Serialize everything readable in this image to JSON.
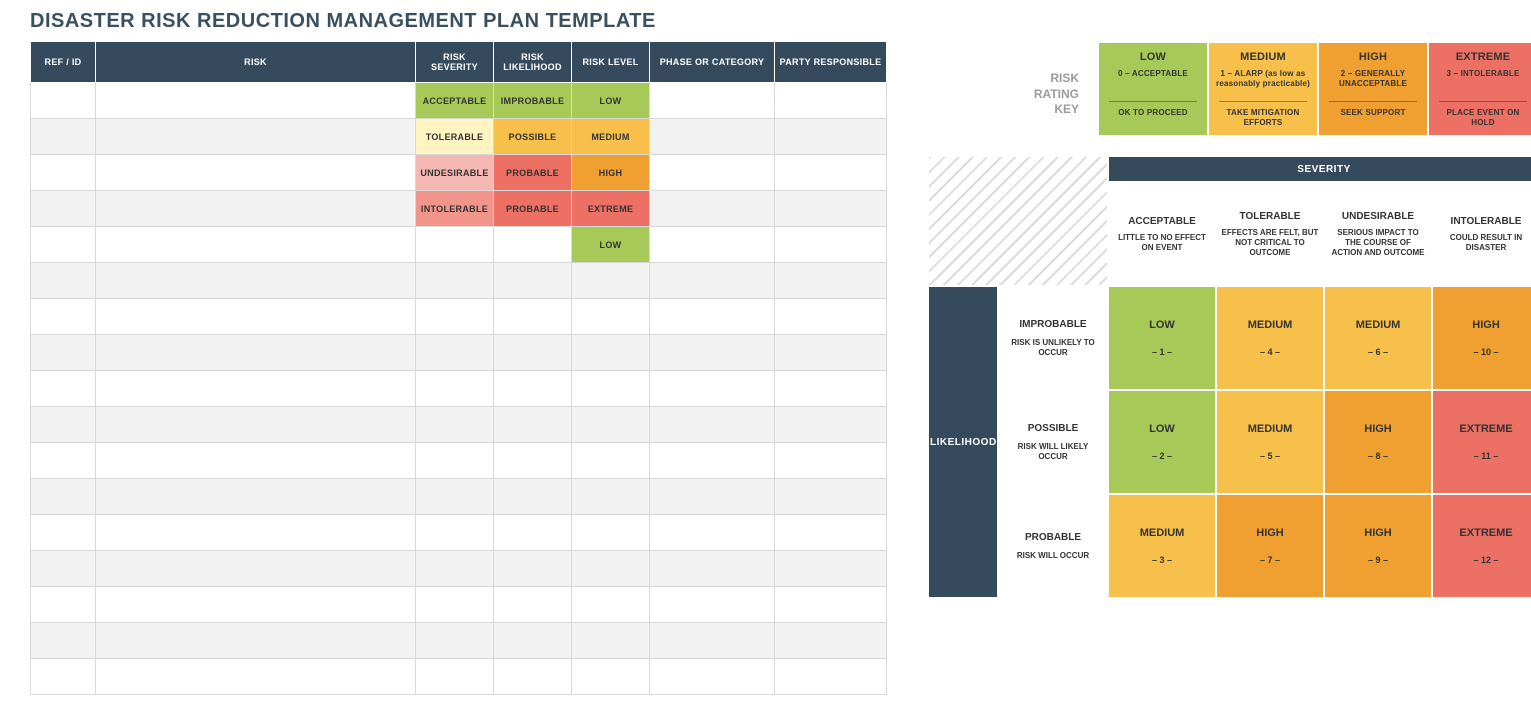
{
  "title": "DISASTER RISK REDUCTION MANAGEMENT PLAN TEMPLATE",
  "table": {
    "headers": [
      "REF / ID",
      "RISK",
      "RISK SEVERITY",
      "RISK LIKELIHOOD",
      "RISK LEVEL",
      "PHASE  OR CATEGORY",
      "PARTY RESPONSIBLE"
    ],
    "rows": [
      {
        "severity": "ACCEPTABLE",
        "likelihood": "IMPROBABLE",
        "level": "LOW",
        "sev_cls": "c-green",
        "lik_cls": "c-green",
        "lvl_cls": "c-green"
      },
      {
        "severity": "TOLERABLE",
        "likelihood": "POSSIBLE",
        "level": "MEDIUM",
        "sev_cls": "c-yellowlt",
        "lik_cls": "c-amber",
        "lvl_cls": "c-amber"
      },
      {
        "severity": "UNDESIRABLE",
        "likelihood": "PROBABLE",
        "level": "HIGH",
        "sev_cls": "c-pinklt",
        "lik_cls": "c-red",
        "lvl_cls": "c-orange"
      },
      {
        "severity": "INTOLERABLE",
        "likelihood": "PROBABLE",
        "level": "EXTREME",
        "sev_cls": "c-pink",
        "lik_cls": "c-red",
        "lvl_cls": "c-red"
      },
      {
        "severity": "",
        "likelihood": "",
        "level": "LOW",
        "sev_cls": "",
        "lik_cls": "",
        "lvl_cls": "c-green"
      },
      {},
      {},
      {},
      {},
      {},
      {},
      {},
      {},
      {},
      {},
      {},
      {}
    ]
  },
  "rating_key": {
    "label_line1": "RISK",
    "label_line2": "RATING",
    "label_line3": "KEY",
    "boxes": [
      {
        "title": "LOW",
        "sub": "0 – ACCEPTABLE",
        "action": "OK TO PROCEED",
        "cls": "c-green"
      },
      {
        "title": "MEDIUM",
        "sub": "1 – ALARP (as low as reasonably practicable)",
        "action": "TAKE MITIGATION EFFORTS",
        "cls": "c-amber"
      },
      {
        "title": "HIGH",
        "sub": "2 – GENERALLY UNACCEPTABLE",
        "action": "SEEK SUPPORT",
        "cls": "c-orange"
      },
      {
        "title": "EXTREME",
        "sub": "3 – INTOLERABLE",
        "action": "PLACE EVENT ON HOLD",
        "cls": "c-red"
      }
    ]
  },
  "matrix": {
    "severity_label": "SEVERITY",
    "likelihood_label": "LIKELIHOOD",
    "severity": [
      {
        "name": "ACCEPTABLE",
        "desc": "LITTLE TO NO EFFECT ON EVENT"
      },
      {
        "name": "TOLERABLE",
        "desc": "EFFECTS ARE FELT, BUT NOT CRITICAL TO OUTCOME"
      },
      {
        "name": "UNDESIRABLE",
        "desc": "SERIOUS IMPACT TO THE COURSE OF ACTION AND OUTCOME"
      },
      {
        "name": "INTOLERABLE",
        "desc": "COULD RESULT IN DISASTER"
      }
    ],
    "likelihood": [
      {
        "name": "IMPROBABLE",
        "desc": "RISK IS UNLIKELY TO OCCUR"
      },
      {
        "name": "POSSIBLE",
        "desc": "RISK WILL LIKELY OCCUR"
      },
      {
        "name": "PROBABLE",
        "desc": "RISK WILL OCCUR"
      }
    ],
    "cells": [
      [
        {
          "lvl": "LOW",
          "num": "– 1 –",
          "cls": "c-green"
        },
        {
          "lvl": "MEDIUM",
          "num": "– 4 –",
          "cls": "c-amber"
        },
        {
          "lvl": "MEDIUM",
          "num": "– 6 –",
          "cls": "c-amber"
        },
        {
          "lvl": "HIGH",
          "num": "– 10 –",
          "cls": "c-orange"
        }
      ],
      [
        {
          "lvl": "LOW",
          "num": "– 2 –",
          "cls": "c-green"
        },
        {
          "lvl": "MEDIUM",
          "num": "– 5 –",
          "cls": "c-amber"
        },
        {
          "lvl": "HIGH",
          "num": "– 8 –",
          "cls": "c-orange"
        },
        {
          "lvl": "EXTREME",
          "num": "– 11 –",
          "cls": "c-red"
        }
      ],
      [
        {
          "lvl": "MEDIUM",
          "num": "– 3 –",
          "cls": "c-amber"
        },
        {
          "lvl": "HIGH",
          "num": "– 7 –",
          "cls": "c-orange"
        },
        {
          "lvl": "HIGH",
          "num": "– 9 –",
          "cls": "c-orange"
        },
        {
          "lvl": "EXTREME",
          "num": "– 12 –",
          "cls": "c-red"
        }
      ]
    ]
  }
}
